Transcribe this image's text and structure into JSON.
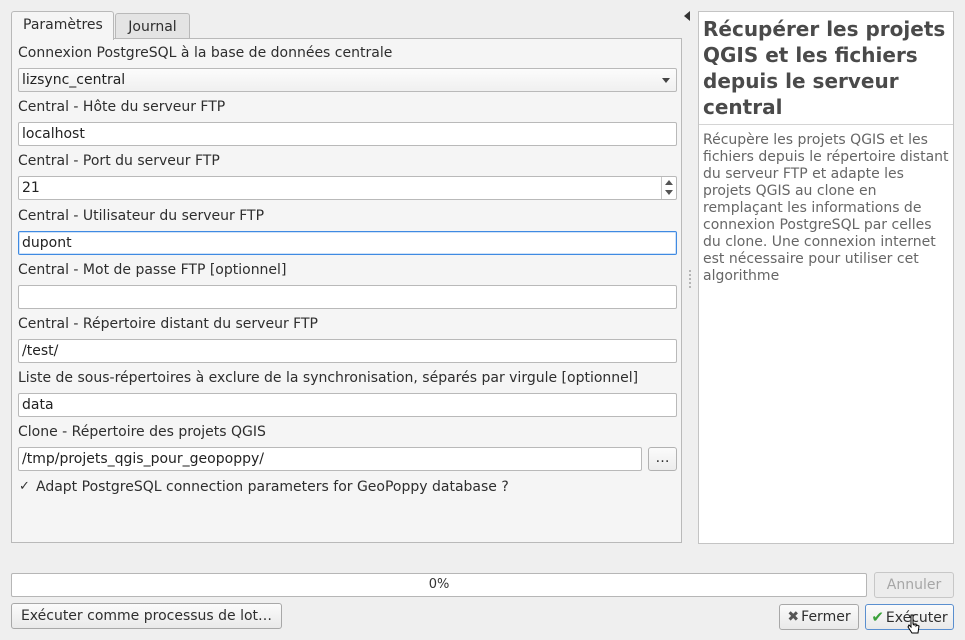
{
  "tabs": [
    {
      "label": "Paramètres",
      "active": true
    },
    {
      "label": "Journal",
      "active": false
    }
  ],
  "params": {
    "connection_label": "Connexion PostgreSQL à la base de données centrale",
    "connection_value": "lizsync_central",
    "host_label": "Central - Hôte du serveur FTP",
    "host_value": "localhost",
    "port_label": "Central - Port du serveur FTP",
    "port_value": "21",
    "user_label": "Central - Utilisateur du serveur FTP",
    "user_value": "dupont",
    "password_label": "Central - Mot de passe FTP [optionnel]",
    "password_value": "",
    "remote_dir_label": "Central - Répertoire distant du serveur FTP",
    "remote_dir_value": "/test/",
    "exclude_label": "Liste de sous-répertoires à exclure de la synchronisation, séparés par virgule [optionnel]",
    "exclude_value": "data",
    "clone_dir_label": "Clone - Répertoire des projets QGIS",
    "clone_dir_value": "/tmp/projets_qgis_pour_geopoppy/",
    "browse_label": "…",
    "geopoppy_checkbox_label": "Adapt PostgreSQL connection parameters for GeoPoppy database ?",
    "geopoppy_checked": true
  },
  "help": {
    "title": "Récupérer les projets QGIS et les fichiers depuis le serveur central",
    "description": "Récupère les projets QGIS et les fichiers depuis le répertoire distant du serveur FTP et adapte les projets QGIS au clone en remplaçant les informations de connexion PostgreSQL par celles du clone. Une connexion internet est nécessaire pour utiliser cet algorithme"
  },
  "footer": {
    "progress_text": "0%",
    "progress_value": 0,
    "cancel_label": "Annuler",
    "batch_label": "Exécuter comme processus de lot…",
    "close_label": "Fermer",
    "run_label": "Exécuter"
  },
  "icons": {
    "checkbox": "check-mark",
    "close": "x-icon",
    "run": "check-icon"
  }
}
